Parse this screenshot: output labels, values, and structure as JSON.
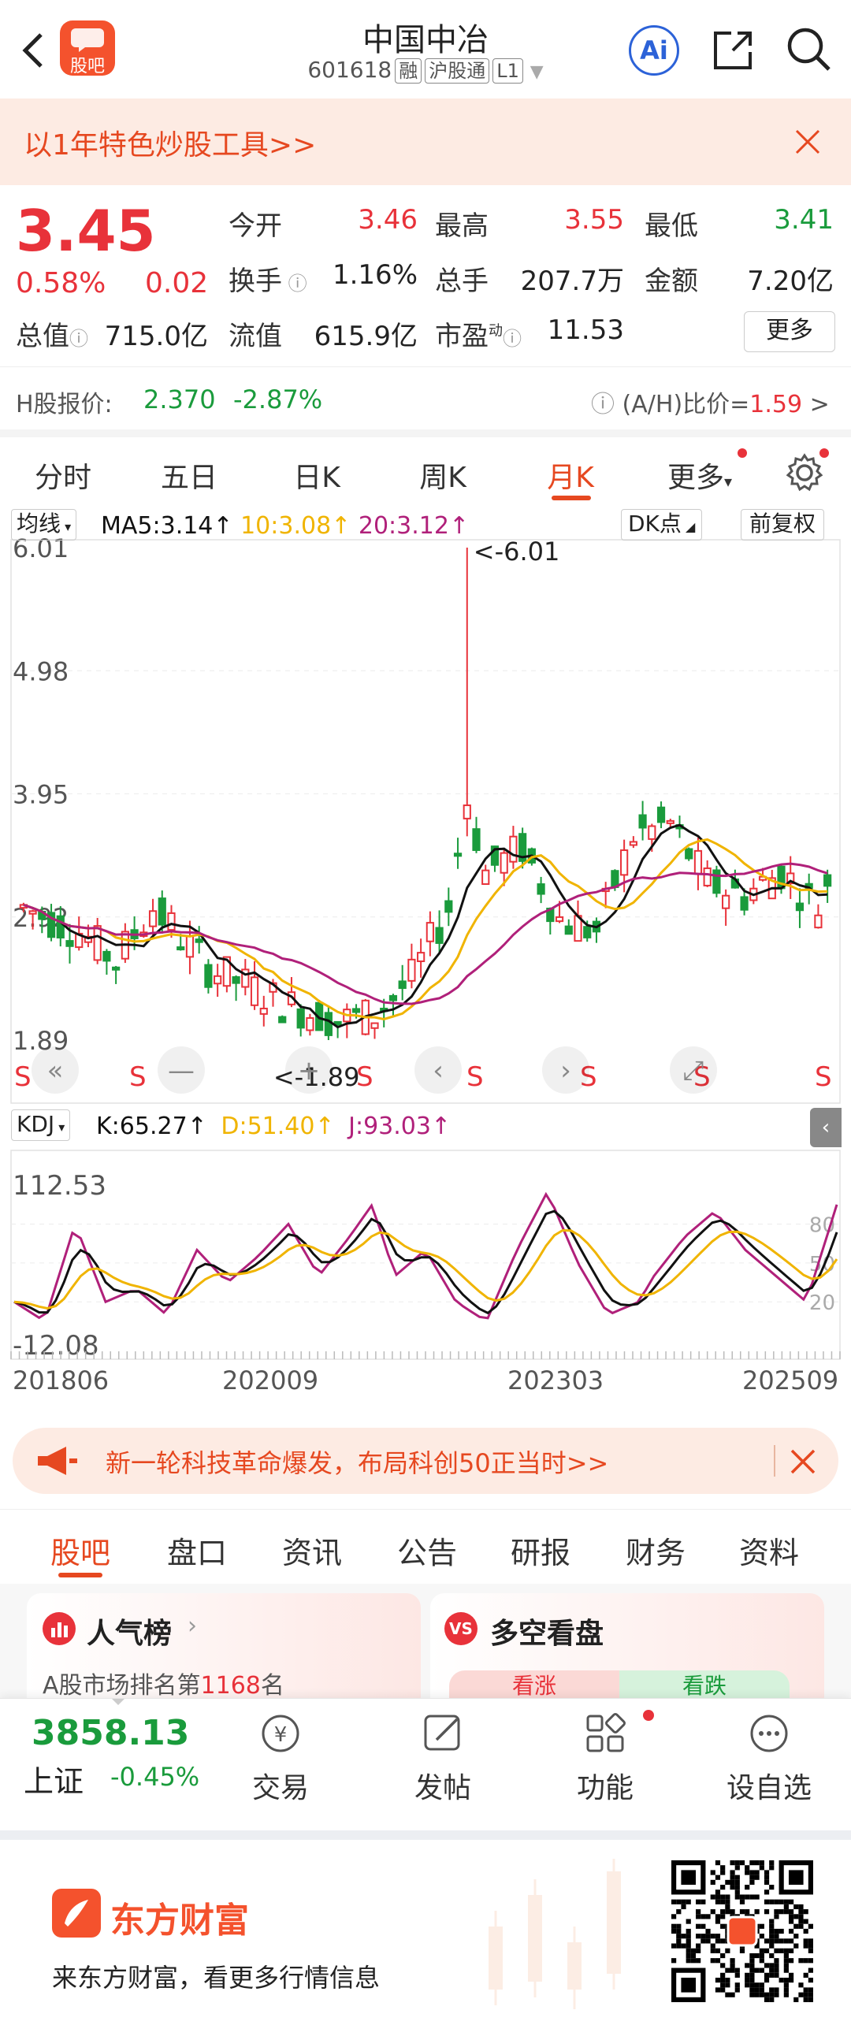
{
  "header": {
    "title": "中国中冶",
    "code": "601618",
    "tags": [
      "融",
      "沪股通",
      "L1"
    ],
    "logo_label": "股吧",
    "ai_label": "Ai"
  },
  "banner": {
    "text": "以1年特色炒股工具>>"
  },
  "quote": {
    "price": "3.45",
    "change_pct": "0.58%",
    "change": "0.02",
    "open_label": "今开",
    "open": "3.46",
    "high_label": "最高",
    "high": "3.55",
    "low_label": "最低",
    "low": "3.41",
    "turnover_label": "换手",
    "turnover": "1.16%",
    "volume_label": "总手",
    "volume": "207.7万",
    "amount_label": "金额",
    "amount": "7.20亿",
    "mktcap_label": "总值",
    "mktcap": "715.0亿",
    "float_label": "流值",
    "float": "615.9亿",
    "pe_label": "市盈",
    "pe_sup": "动",
    "pe": "11.53",
    "more_label": "更多"
  },
  "hshare": {
    "label": "H股报价:",
    "price": "2.370",
    "change": "-2.87%",
    "ah_label": "(A/H)比价=",
    "ah_value": "1.59",
    "arrow": ">"
  },
  "tabs": [
    "分时",
    "五日",
    "日K",
    "周K",
    "月K",
    "更多"
  ],
  "active_tab": 4,
  "kline": {
    "indicator": "均线",
    "ma5": "MA5:3.14↑",
    "ma10": "10:3.08↑",
    "ma20": "20:3.12↑",
    "dk_label": "DK点",
    "adjust_label": "前复权",
    "price_labels": [
      "6.01",
      "4.98",
      "3.95",
      "2.92",
      "1.89"
    ],
    "max_label": "<-6.01",
    "min_label": "<-1.89",
    "s_marks": [
      "S",
      "S",
      "S",
      "S",
      "S",
      "S",
      "S",
      "S"
    ],
    "colors": {
      "up": "#e8323a",
      "down": "#1a9b3c",
      "ma5": "#111111",
      "ma10": "#f0b400",
      "ma20": "#b0207a"
    }
  },
  "kdj": {
    "indicator": "KDJ",
    "k": "K:65.27↑",
    "d": "D:51.40↑",
    "j": "J:93.03↑",
    "top": "112.53",
    "bottom": "-12.08",
    "levels": [
      "80",
      "50",
      "20"
    ],
    "dates": [
      "201806",
      "202009",
      "202303",
      "202509"
    ]
  },
  "ad2": {
    "text": "新一轮科技革命爆发，布局科创50正当时>>"
  },
  "subtabs": [
    "股吧",
    "盘口",
    "资讯",
    "公告",
    "研报",
    "财务",
    "资料"
  ],
  "cards": {
    "left_title": "人气榜",
    "left_sub_a": "A股市场排名第",
    "left_rank": "1168",
    "left_sub_b": "名",
    "right_title": "多空看盘",
    "bull": "看涨",
    "bear": "看跌"
  },
  "bottom": {
    "index_value": "3858.13",
    "index_name": "上证",
    "index_change": "-0.45%",
    "nav": [
      "交易",
      "发帖",
      "功能",
      "设自选"
    ]
  },
  "footer": {
    "brand": "东方财富",
    "slogan": "来东方财富，看更多行情信息"
  }
}
